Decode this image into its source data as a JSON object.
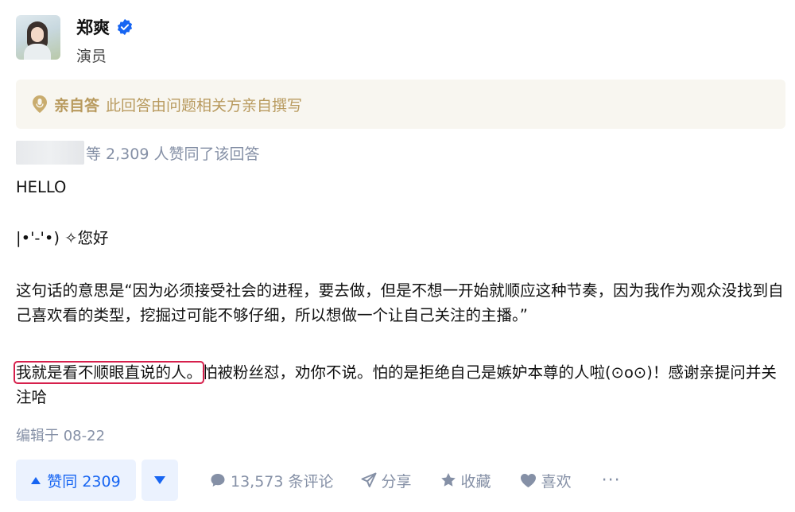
{
  "author": {
    "name": "郑爽",
    "title": "演员"
  },
  "banner": {
    "label": "亲自答",
    "text": "此回答由问题相关方亲自撰写"
  },
  "voters": {
    "text": "等 2,309 人赞同了该回答"
  },
  "answer": {
    "line1": "HELLO",
    "line2": "|•'-'•) ✧您好",
    "line3": "这句话的意思是“因为必须接受社会的进程，要去做，但是不想一开始就顺应这种节奏，因为我作为观众没找到自己喜欢看的类型，挖掘过可能不够仔细，所以想做一个让自己关注的主播。”",
    "line4_highlight": "我就是看不顺眼直说的人。",
    "line4_rest": "怕被粉丝怼，劝你不说。怕的是拒绝自己是嫉妒本尊的人啦(⊙o⊙)！感谢亲提问并关注哈"
  },
  "edited": "编辑于 08-22",
  "actions": {
    "vote_up": "赞同 2309",
    "comments": "13,573 条评论",
    "share": "分享",
    "favorite": "收藏",
    "like": "喜欢",
    "more": "···"
  },
  "colors": {
    "accent": "#1765f2",
    "muted": "#8590a6",
    "banner_text": "#b89a5e",
    "highlight_border": "#d6204c"
  }
}
